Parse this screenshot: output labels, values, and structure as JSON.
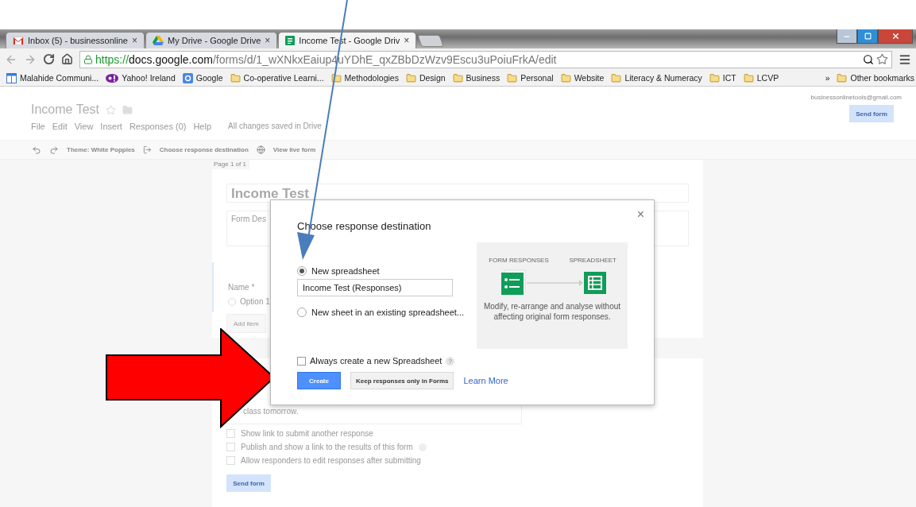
{
  "browser": {
    "tabs": [
      {
        "title": "Inbox (5) - businessonline",
        "kind": "mail",
        "selected": false,
        "close": "×"
      },
      {
        "title": "My Drive - Google Drive",
        "kind": "drive",
        "selected": false,
        "close": "×"
      },
      {
        "title": "Income Test - Google Driv",
        "kind": "forms",
        "selected": true,
        "close": "×"
      }
    ],
    "url": {
      "scheme": "https://",
      "host": "docs.google.com",
      "path": "/forms/d/1_wXNkxEaiup4uYDhE_qxZBbDzWzv9Escu3uPoiuFrkA/edit"
    },
    "bookmarks": [
      {
        "label": "Malahide Communi...",
        "kind": "calendar"
      },
      {
        "label": "Yahoo! Ireland",
        "kind": "yahoo"
      },
      {
        "label": "Google",
        "kind": "google"
      },
      {
        "label": "Co-operative Learni...",
        "kind": "folder"
      },
      {
        "label": "Methodologies",
        "kind": "folder"
      },
      {
        "label": "Design",
        "kind": "folder"
      },
      {
        "label": "Business",
        "kind": "folder"
      },
      {
        "label": "Personal",
        "kind": "folder"
      },
      {
        "label": "Website",
        "kind": "folder"
      },
      {
        "label": "Literacy & Numeracy",
        "kind": "folder"
      },
      {
        "label": "ICT",
        "kind": "folder"
      },
      {
        "label": "LCVP",
        "kind": "folder"
      }
    ],
    "more": "»",
    "other_bookmarks": "Other bookmarks"
  },
  "header": {
    "title": "Income Test",
    "menu": [
      "File",
      "Edit",
      "View",
      "Insert",
      "Responses (0)",
      "Help"
    ],
    "save_status": "All changes saved in Drive",
    "account": "businessonlinetools@gmail.com",
    "send_button": "Send form"
  },
  "toolbar": {
    "theme": "Theme: White Poppies",
    "destination": "Choose response destination",
    "live": "View live form"
  },
  "form": {
    "page_label": "Page 1 of 1",
    "title": "Income Test",
    "description_placeholder": "Form Des",
    "question": "Name *",
    "option": {
      "label": "Option 1",
      "selected": false
    },
    "add_item": "Add item",
    "confirmation": "class tomorrow.",
    "settings": [
      {
        "label": "Show link to submit another response",
        "checked": false,
        "help": false
      },
      {
        "label": "Publish and show a link to the results of this form",
        "checked": false,
        "help": true
      },
      {
        "label": "Allow responders to edit responses after submitting",
        "checked": false,
        "help": false
      }
    ],
    "send_button": "Send form"
  },
  "dialog": {
    "title": "Choose response destination",
    "close": "×",
    "options": [
      {
        "label": "New spreadsheet",
        "selected": true
      },
      {
        "label": "New sheet in an existing spreadsheet...",
        "selected": false
      }
    ],
    "name_value": "Income Test (Responses)",
    "always_new": {
      "label": "Always create a new Spreadsheet",
      "checked": false,
      "help": "?"
    },
    "create": "Create",
    "keep": "Keep responses only in Forms",
    "learn_more": "Learn More",
    "illustration": {
      "from": "FORM RESPONSES",
      "to": "SPREADSHEET",
      "caption": "Modify, re-arrange and analyse without affecting original form responses."
    }
  }
}
